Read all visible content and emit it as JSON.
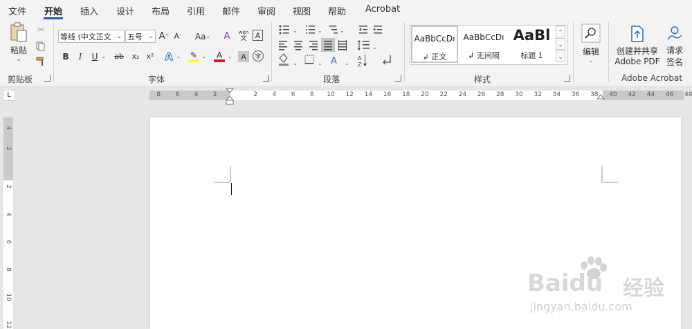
{
  "menu": {
    "tabs": [
      {
        "label": "文件"
      },
      {
        "label": "开始"
      },
      {
        "label": "插入"
      },
      {
        "label": "设计"
      },
      {
        "label": "布局"
      },
      {
        "label": "引用"
      },
      {
        "label": "邮件"
      },
      {
        "label": "审阅"
      },
      {
        "label": "视图"
      },
      {
        "label": "帮助"
      },
      {
        "label": "Acrobat"
      }
    ],
    "active_tab": "开始"
  },
  "ribbon": {
    "clipboard": {
      "paste_label": "粘贴",
      "group_label": "剪贴板"
    },
    "font": {
      "font_name": "等线 (中文正文",
      "font_size": "五号",
      "change_case": "Aa",
      "bold": "B",
      "italic": "I",
      "underline": "U",
      "strike": "ab",
      "subscript": "x₂",
      "superscript": "x²",
      "group_label": "字体",
      "phonetic_top": "wén",
      "phonetic_bottom": "文",
      "border_char": "A",
      "font_color_char": "A",
      "shade_char": "A",
      "enclose_char": "字"
    },
    "paragraph": {
      "group_label": "段落"
    },
    "styles": {
      "items": [
        {
          "sample": "AaBbCcDı",
          "name": "↲ 正文"
        },
        {
          "sample": "AaBbCcDı",
          "name": "↲ 无间隔"
        },
        {
          "sample": "AaBl",
          "name": "标题 1"
        }
      ],
      "group_label": "样式"
    },
    "editing": {
      "label": "编辑"
    },
    "acrobat": {
      "create_label_line1": "创建并共享",
      "create_label_line2": "Adobe PDF",
      "sign_label_line1": "请求",
      "sign_label_line2": "签名",
      "group_label": "Adobe Acrobat"
    }
  },
  "ruler": {
    "corner_mark": "L",
    "horizontal_ticks": [
      "8",
      "6",
      "4",
      "2",
      "2",
      "4",
      "6",
      "8",
      "10",
      "12",
      "14",
      "16",
      "18",
      "20",
      "22",
      "24",
      "26",
      "28",
      "30",
      "32",
      "34",
      "36",
      "38",
      "40",
      "42",
      "44",
      "46",
      "48"
    ],
    "vertical_ticks": [
      "4",
      "2",
      "2",
      "4",
      "6",
      "8",
      "10",
      "12"
    ]
  },
  "watermark": {
    "brand": "Baidu",
    "cn": "经验",
    "url": "jingyan.baidu.com"
  },
  "colors": {
    "accent": "#2b579a",
    "highlight": "#ffff00",
    "font_color": "#e81123"
  }
}
